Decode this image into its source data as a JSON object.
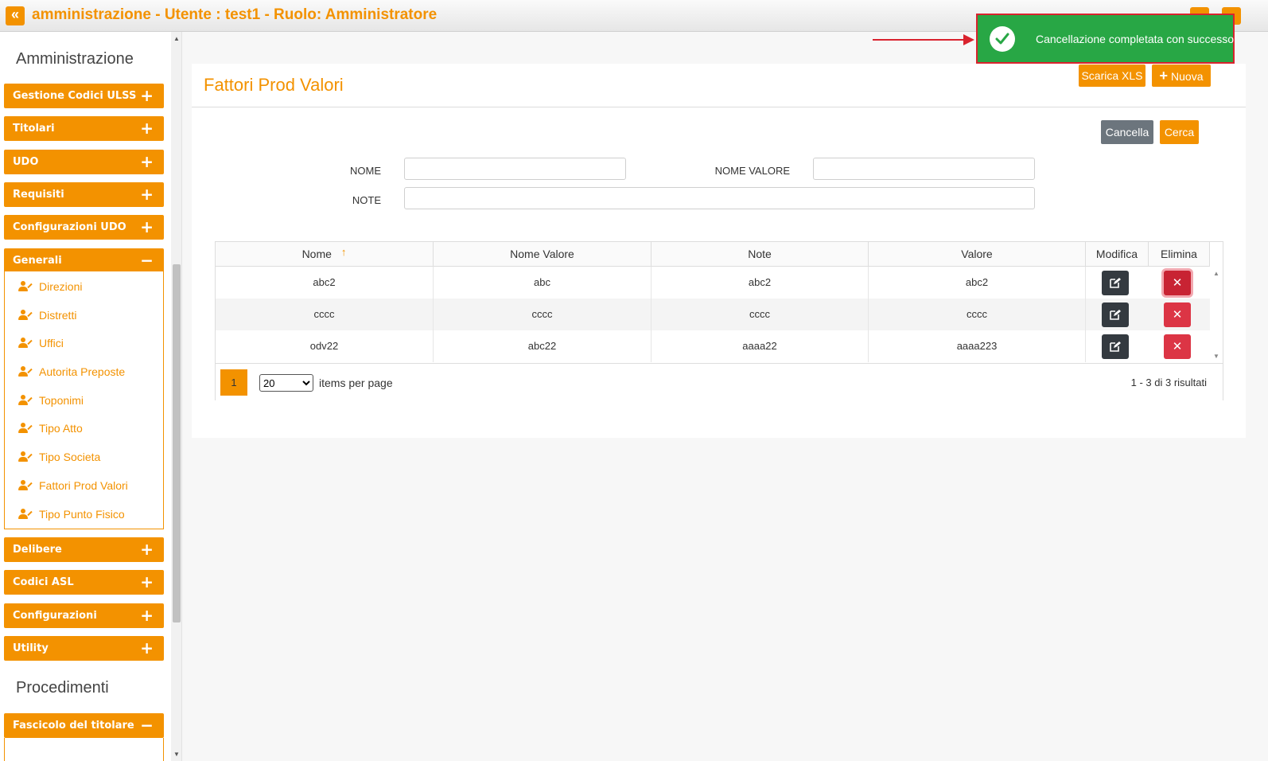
{
  "header": {
    "collapse_glyph": "«",
    "title": "amministrazione - Utente : test1 - Ruolo: Amministratore"
  },
  "sidebar": {
    "section1": "Amministrazione",
    "menus_top": [
      {
        "label": "Gestione Codici ULSS",
        "sign": "+"
      },
      {
        "label": "Titolari",
        "sign": "+"
      },
      {
        "label": "UDO",
        "sign": "+"
      },
      {
        "label": "Requisiti",
        "sign": "+"
      },
      {
        "label": "Configurazioni UDO",
        "sign": "+"
      },
      {
        "label": "Generali",
        "sign": "−"
      }
    ],
    "generali_items": [
      "Direzioni",
      "Distretti",
      "Uffici",
      "Autorita Preposte",
      "Toponimi",
      "Tipo Atto",
      "Tipo Societa",
      "Fattori Prod Valori",
      "Tipo Punto Fisico"
    ],
    "menus_bottom": [
      {
        "label": "Delibere",
        "sign": "+"
      },
      {
        "label": "Codici ASL",
        "sign": "+"
      },
      {
        "label": "Configurazioni",
        "sign": "+"
      },
      {
        "label": "Utility",
        "sign": "+"
      }
    ],
    "section2": "Procedimenti",
    "menus_proc": [
      {
        "label": "Fascicolo del titolare",
        "sign": "−"
      }
    ]
  },
  "page": {
    "title": "Fattori Prod Valori",
    "download_label": "Scarica XLS",
    "new_label": "Nuova",
    "new_icon": "plus-icon",
    "clear_label": "Cancella",
    "search_label": "Cerca"
  },
  "filters": {
    "nome_label": "NOME",
    "nome_value": "",
    "nome_valore_label": "NOME VALORE",
    "nome_valore_value": "",
    "note_label": "NOTE",
    "note_value": ""
  },
  "table": {
    "columns": [
      "Nome",
      "Nome Valore",
      "Note",
      "Valore",
      "Modifica",
      "Elimina"
    ],
    "sort_indicator": "↑",
    "rows": [
      {
        "nome": "abc2",
        "nome_valore": "abc",
        "note": "abc2",
        "valore": "abc2"
      },
      {
        "nome": "cccc",
        "nome_valore": "cccc",
        "note": "cccc",
        "valore": "cccc"
      },
      {
        "nome": "odv22",
        "nome_valore": "abc22",
        "note": "aaaa22",
        "valore": "aaaa223"
      }
    ],
    "delete_glyph": "✕",
    "edit_icon": "edit-icon"
  },
  "pager": {
    "current_page": "1",
    "page_size": "20",
    "page_size_options": [
      "20"
    ],
    "items_per_page": "items per page",
    "results": "1 - 3 di 3 risultati"
  },
  "toast": {
    "message": "Cancellazione completata con successo",
    "icon": "check-circle-icon"
  },
  "colors": {
    "brand": "#f39200",
    "success": "#28a745",
    "danger": "#dc3545",
    "dark": "#343a40",
    "annotation": "#d9232e"
  }
}
